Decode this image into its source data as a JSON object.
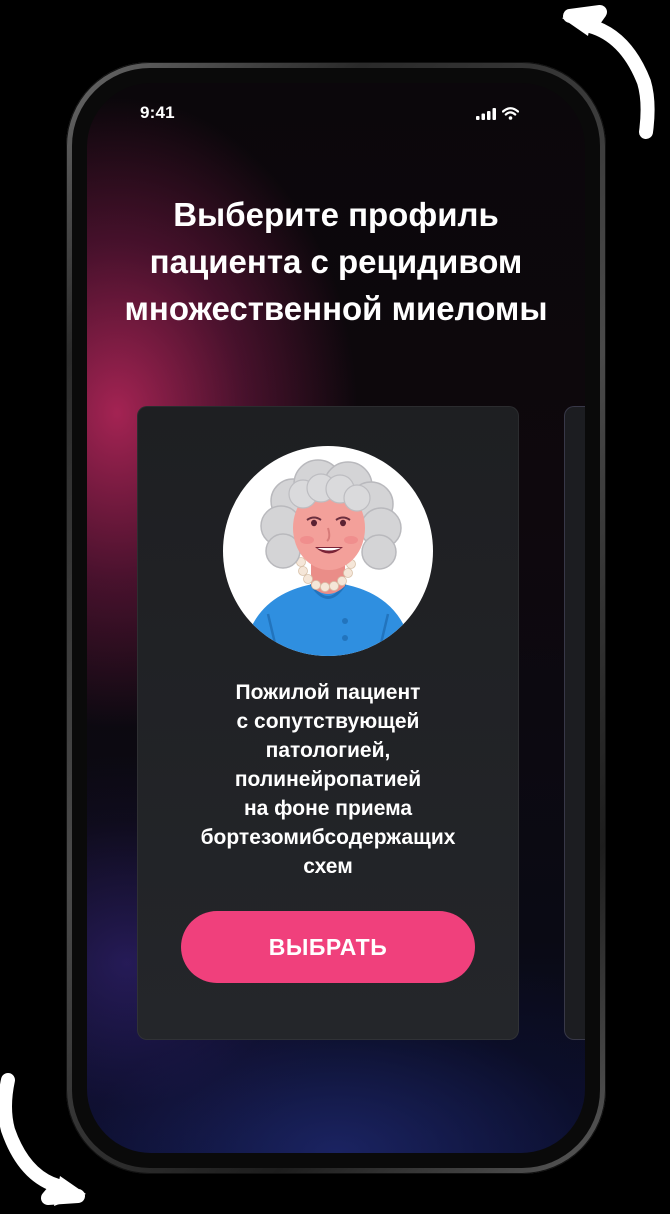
{
  "status_bar": {
    "time": "9:41"
  },
  "screen": {
    "title": "Выберите профиль пациента с рецидивом множественной миеломы"
  },
  "profile_card": {
    "description_lines": [
      "Пожилой пациент",
      "с сопутствующей",
      "патологией,",
      "полинейропатией",
      "на фоне приема",
      "бортезомибсодержащих",
      "схем"
    ],
    "button_label": "ВЫБРАТЬ"
  },
  "colors": {
    "accent_button": "#f0407c",
    "card_background": "#222428",
    "avatar_shirt": "#2f8fe0",
    "avatar_hair": "#d4d4d6",
    "avatar_skin": "#f3a09a"
  },
  "icons": [
    "rotate-arrow-icon",
    "signal-icon",
    "wifi-icon",
    "battery-icon"
  ]
}
